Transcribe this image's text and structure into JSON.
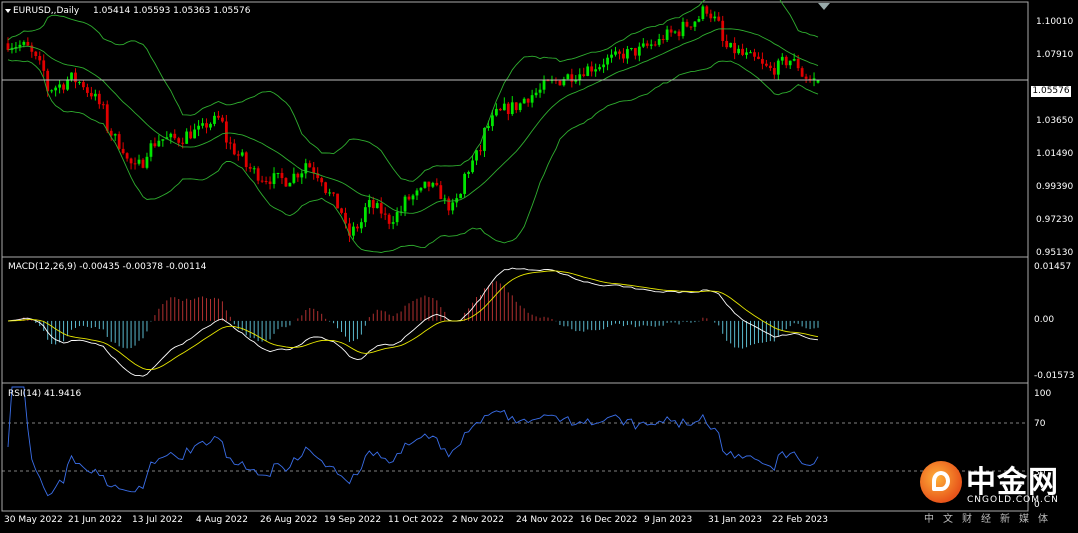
{
  "header": {
    "symbol": "EURUSD,,Daily",
    "ohlc": "1.05414 1.05593 1.05363 1.05576"
  },
  "last_price": "1.05576",
  "macd": {
    "label": "MACD(12,26,9) -0.00435 -0.00378 -0.00114",
    "ticks": [
      "0.01457",
      "0.00",
      "-0.01573"
    ]
  },
  "rsi": {
    "label": "RSI(14) 41.9416",
    "ticks": [
      "100",
      "70",
      "30",
      "0"
    ]
  },
  "price_ticks": [
    "1.10010",
    "1.07910",
    "1.05576",
    "1.03650",
    "1.01490",
    "0.99390",
    "0.97230",
    "0.95130"
  ],
  "date_labels": [
    "30 May 2022",
    "21 Jun 2022",
    "13 Jul 2022",
    "4 Aug 2022",
    "26 Aug 2022",
    "19 Sep 2022",
    "11 Oct 2022",
    "2 Nov 2022",
    "24 Nov 2022",
    "16 Dec 2022",
    "9 Jan 2023",
    "31 Jan 2023",
    "22 Feb 2023"
  ],
  "logo": {
    "name": "中金网",
    "url": "CNGOLD.COM.CN",
    "subtitle": "中文财经新媒体"
  },
  "colors": {
    "bull": "#00e600",
    "bear": "#e00000",
    "bands": "#2fae2f",
    "macd_line": "#ffffff",
    "signal_line": "#e6e600",
    "hist_pos": "#b03030",
    "hist_neg": "#5ab8cc",
    "rsi_line": "#3a6ee8"
  },
  "chart_data": [
    {
      "type": "candlestick",
      "title": "EURUSD,,Daily",
      "x_range": [
        "2022-05-30",
        "2023-03-10"
      ],
      "ylim": [
        0.951,
        1.1
      ],
      "trend_close": [
        [
          "2022-05-30",
          1.078
        ],
        [
          "2022-06-06",
          1.075
        ],
        [
          "2022-06-13",
          1.05
        ],
        [
          "2022-06-21",
          1.057
        ],
        [
          "2022-06-28",
          1.048
        ],
        [
          "2022-07-06",
          1.02
        ],
        [
          "2022-07-13",
          1.002
        ],
        [
          "2022-07-21",
          1.02
        ],
        [
          "2022-07-28",
          1.02
        ],
        [
          "2022-08-04",
          1.025
        ],
        [
          "2022-08-11",
          1.032
        ],
        [
          "2022-08-18",
          1.01
        ],
        [
          "2022-08-26",
          0.997
        ],
        [
          "2022-09-05",
          0.995
        ],
        [
          "2022-09-12",
          1.006
        ],
        [
          "2022-09-19",
          0.99
        ],
        [
          "2022-09-27",
          0.962
        ],
        [
          "2022-10-04",
          0.98
        ],
        [
          "2022-10-11",
          0.971
        ],
        [
          "2022-10-18",
          0.984
        ],
        [
          "2022-10-25",
          0.992
        ],
        [
          "2022-11-02",
          0.978
        ],
        [
          "2022-11-10",
          1.01
        ],
        [
          "2022-11-17",
          1.035
        ],
        [
          "2022-11-24",
          1.04
        ],
        [
          "2022-12-01",
          1.048
        ],
        [
          "2022-12-08",
          1.055
        ],
        [
          "2022-12-16",
          1.06
        ],
        [
          "2022-12-23",
          1.065
        ],
        [
          "2022-12-30",
          1.07
        ],
        [
          "2023-01-09",
          1.075
        ],
        [
          "2023-01-16",
          1.082
        ],
        [
          "2023-01-23",
          1.088
        ],
        [
          "2023-01-31",
          1.099
        ],
        [
          "2023-02-07",
          1.075
        ],
        [
          "2023-02-14",
          1.07
        ],
        [
          "2023-02-22",
          1.062
        ],
        [
          "2023-03-01",
          1.068
        ],
        [
          "2023-03-08",
          1.0558
        ]
      ],
      "series": [
        {
          "name": "EURUSD,,Daily",
          "last": {
            "open": 1.05414,
            "high": 1.05593,
            "low": 1.05363,
            "close": 1.05576
          }
        }
      ]
    },
    {
      "type": "bar",
      "title": "MACD(12,26,9) -0.00435 -0.00378 -0.00114",
      "ylim": [
        -0.01573,
        0.01457
      ],
      "series": [
        {
          "name": "MACD(12,26,9)",
          "last": -0.00435
        },
        {
          "name": "signal",
          "last": -0.00378
        },
        {
          "name": "histogram",
          "last": -0.00114
        }
      ]
    },
    {
      "type": "line",
      "title": "RSI(14) 41.9416",
      "ylim": [
        0,
        100
      ],
      "levels": [
        30,
        70
      ],
      "series": [
        {
          "name": "RSI(14)",
          "last": 41.9416
        }
      ]
    }
  ]
}
